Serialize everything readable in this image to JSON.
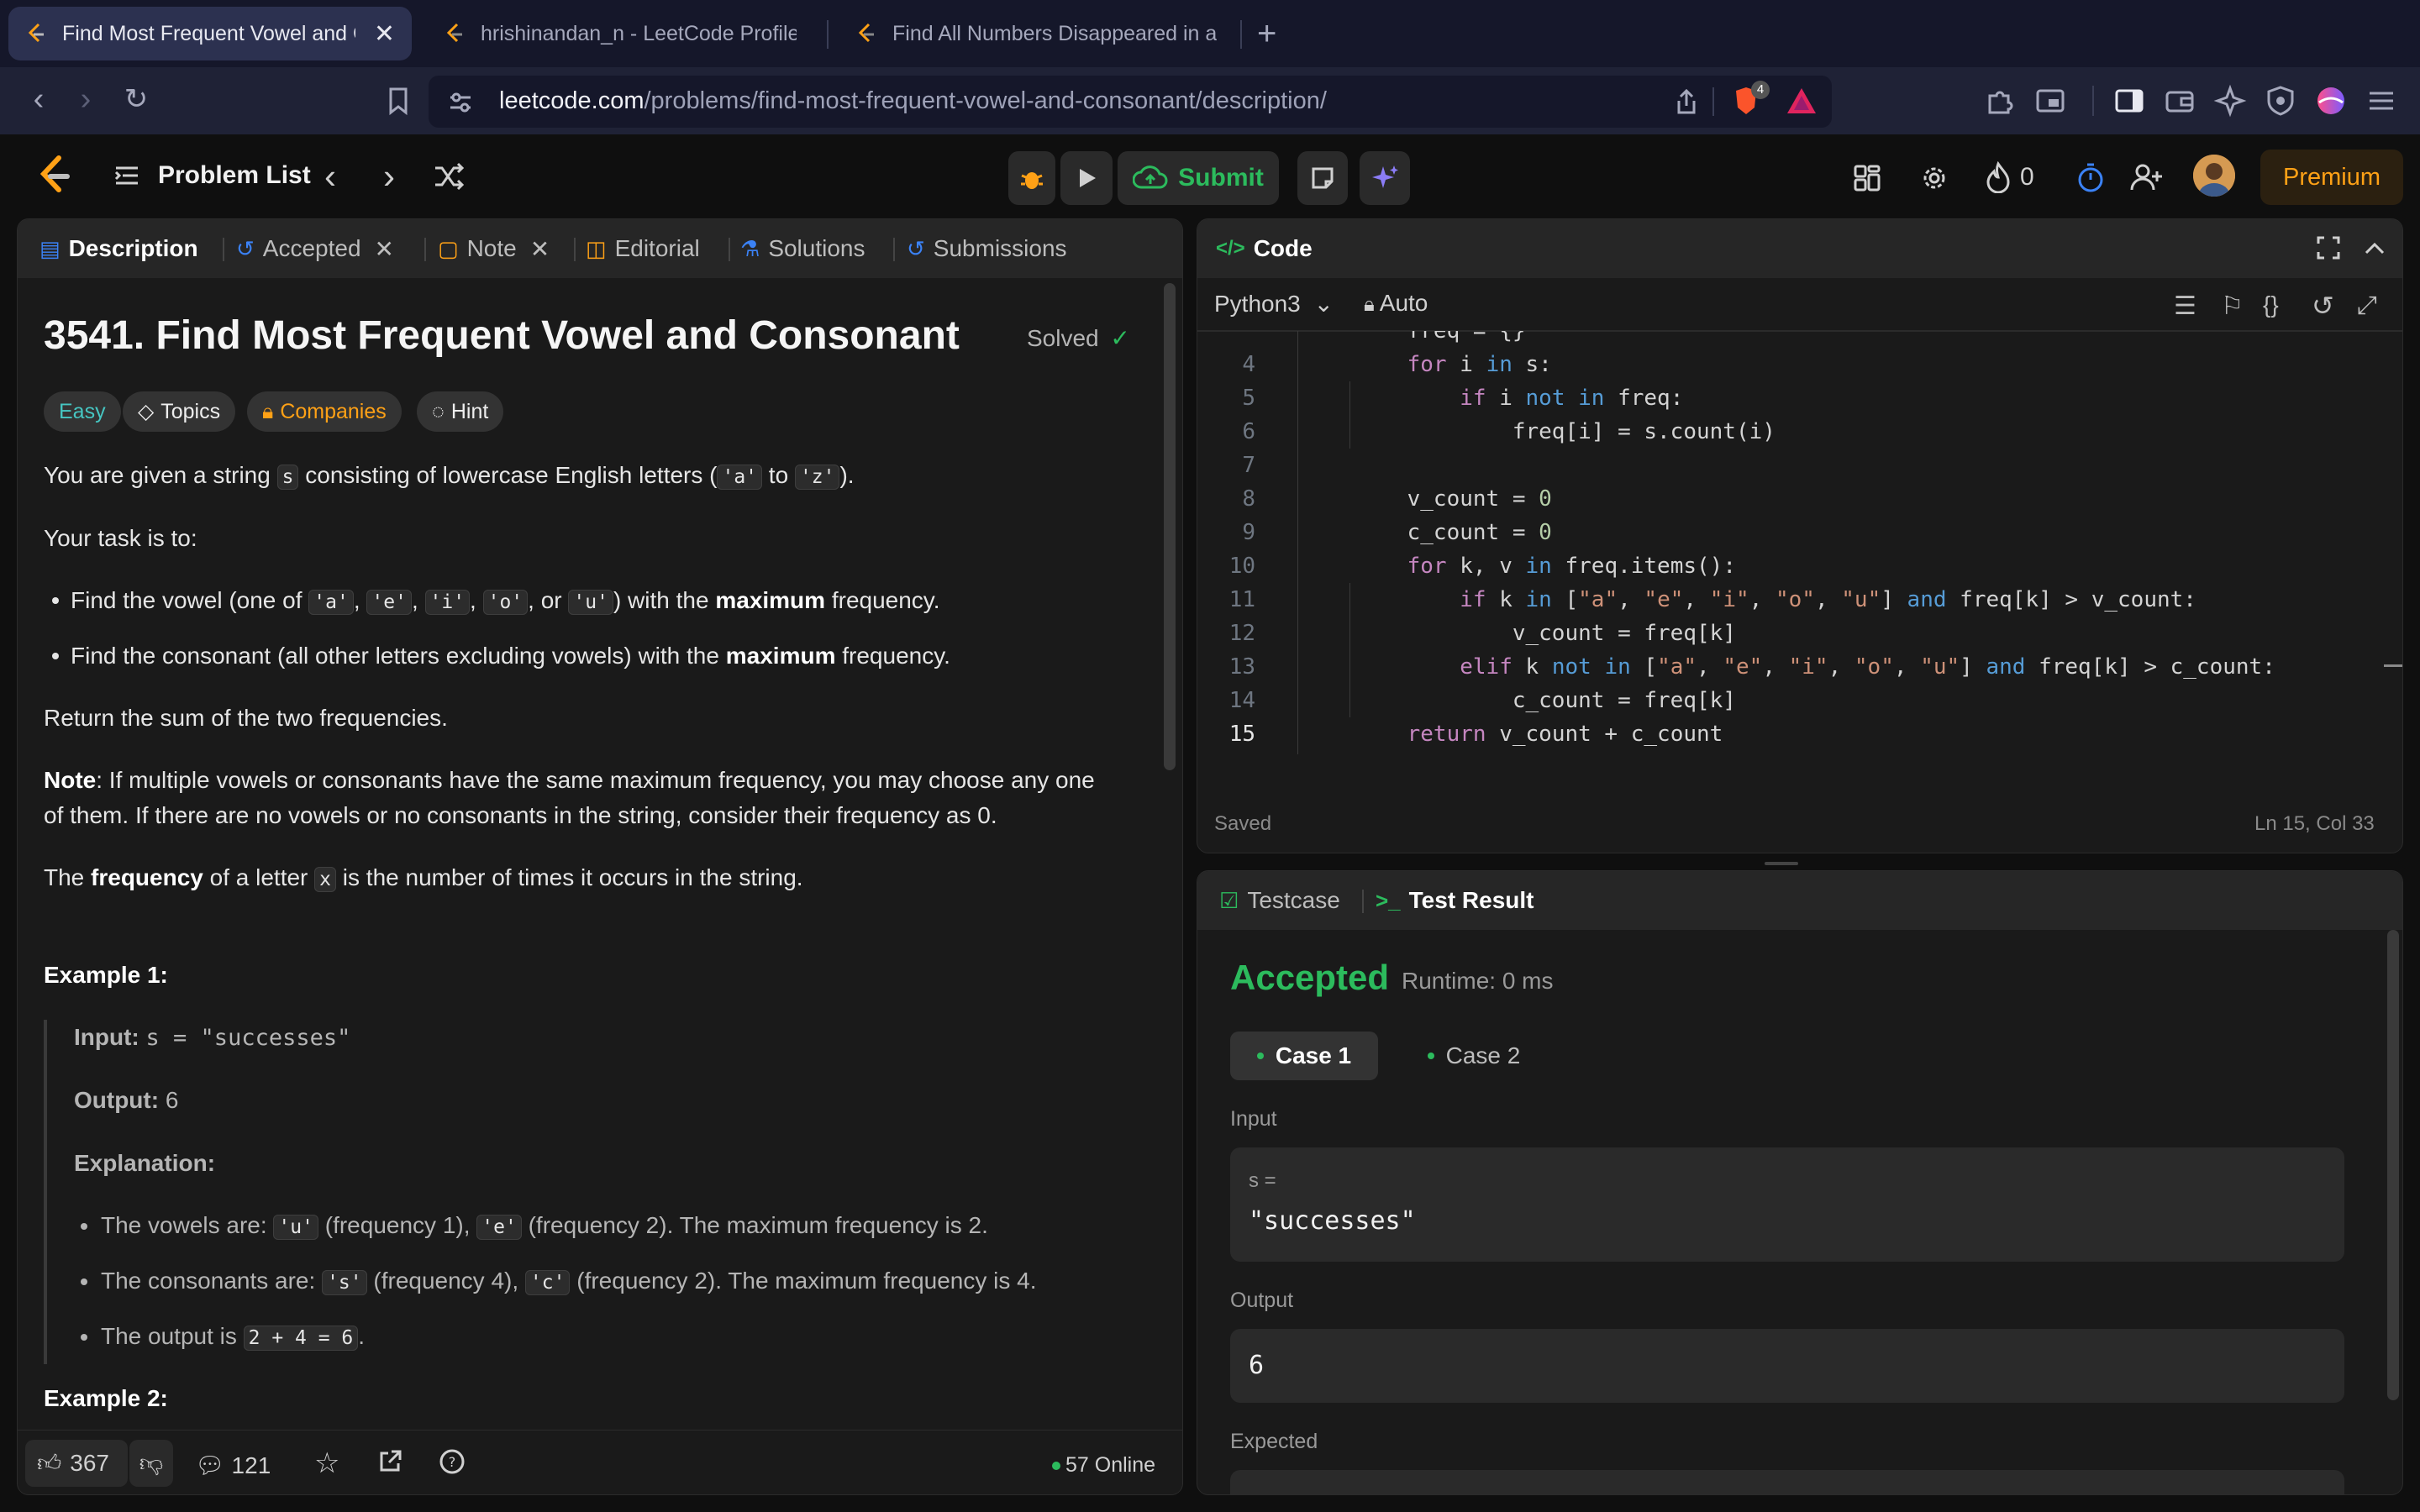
{
  "browser": {
    "tabs": [
      {
        "title": "Find Most Frequent Vowel and Consonant"
      },
      {
        "title": "hrishinandan_n - LeetCode Profile"
      },
      {
        "title": "Find All Numbers Disappeared in an Array"
      }
    ],
    "url_host": "leetcode.com",
    "url_path": "/problems/find-most-frequent-vowel-and-consonant/description/",
    "brave_badge": "4"
  },
  "topbar": {
    "problem_list": "Problem List",
    "submit": "Submit",
    "streak": "0",
    "premium": "Premium"
  },
  "left_tabs": {
    "description": "Description",
    "accepted": "Accepted",
    "note": "Note",
    "editorial": "Editorial",
    "solutions": "Solutions",
    "submissions": "Submissions"
  },
  "problem": {
    "title": "3541. Find Most Frequent Vowel and Consonant",
    "status": "Solved",
    "tags": {
      "difficulty": "Easy",
      "topics": "Topics",
      "companies": "Companies",
      "hint": "Hint"
    },
    "p1_a": "You are given a string",
    "p1_code_s": "s",
    "p1_b": "consisting of lowercase English letters (",
    "p1_code_a": "'a'",
    "p1_to": "to",
    "p1_code_z": "'z'",
    "p1_end": ").",
    "task": "Your task is to:",
    "b1_a": "Find the vowel (one of",
    "v_a": "'a'",
    "v_e": "'e'",
    "v_i": "'i'",
    "v_o": "'o'",
    "v_u": "'u'",
    "b1_or": ", or",
    "b1_with": ") with the",
    "maximum": "maximum",
    "frequency": "frequency.",
    "b2_a": "Find the consonant (all other letters excluding vowels) with the",
    "return": "Return the sum of the two frequencies.",
    "note_label": "Note",
    "note_1": ": If multiple vowels or consonants have the same maximum frequency, you may choose any one",
    "note_2": "of them. If there are no vowels or no consonants in the string, consider their frequency as 0.",
    "freq_a": "The",
    "freq_b": "frequency",
    "freq_c": "of a letter",
    "freq_x": "x",
    "freq_d": "is the number of times it occurs in the string.",
    "ex1_title": "Example 1:",
    "ex1_input_label": "Input:",
    "ex1_input": "s = \"successes\"",
    "ex1_output_label": "Output:",
    "ex1_output": "6",
    "ex1_expl_label": "Explanation:",
    "e1_a": "The vowels are:",
    "e1_u": "'u'",
    "e1_b": "(frequency 1),",
    "e1_e": "'e'",
    "e1_c": "(frequency 2). The maximum frequency is 2.",
    "e2_a": "The consonants are:",
    "e2_s": "'s'",
    "e2_b": "(frequency 4),",
    "e2_c_code": "'c'",
    "e2_c": "(frequency 2). The maximum frequency is 4.",
    "e3_a": "The output is",
    "e3_code": "2 + 4 = 6",
    "e3_end": ".",
    "ex2_title": "Example 2:"
  },
  "desc_footer": {
    "likes": "367",
    "comments": "121",
    "online": "57 Online"
  },
  "code_panel": {
    "title": "Code",
    "language": "Python3",
    "auto": "Auto",
    "saved": "Saved",
    "cursor": "Ln 15, Col 33",
    "partial_line": "freq = {}",
    "lines": [
      {
        "n": "4"
      },
      {
        "n": "5"
      },
      {
        "n": "6"
      },
      {
        "n": "7"
      },
      {
        "n": "8"
      },
      {
        "n": "9"
      },
      {
        "n": "10"
      },
      {
        "n": "11"
      },
      {
        "n": "12"
      },
      {
        "n": "13"
      },
      {
        "n": "14"
      },
      {
        "n": "15"
      }
    ]
  },
  "test_panel": {
    "testcase": "Testcase",
    "test_result": "Test Result",
    "verdict": "Accepted",
    "runtime": "Runtime: 0 ms",
    "case1": "Case 1",
    "case2": "Case 2",
    "input_label": "Input",
    "input_var": "s =",
    "input_val": "\"successes\"",
    "output_label": "Output",
    "output_val": "6",
    "expected_label": "Expected"
  },
  "colors": {
    "accent": "#ffa116",
    "success": "#2cbb5d",
    "easy": "#46c6c2",
    "bg": "#1a1a1a"
  }
}
